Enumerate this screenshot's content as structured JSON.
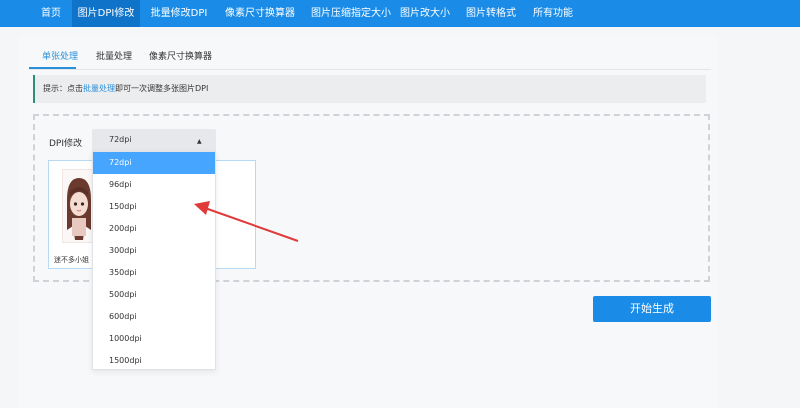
{
  "nav": {
    "items": [
      {
        "label": "首页"
      },
      {
        "label": "图片DPI修改"
      },
      {
        "label": "批量修改DPI"
      },
      {
        "label": "像素尺寸换算器"
      },
      {
        "label": "图片压缩指定大小"
      },
      {
        "label": "图片改大小"
      },
      {
        "label": "图片转格式"
      },
      {
        "label": "所有功能"
      }
    ],
    "active_index": 1
  },
  "tabs": [
    {
      "label": "单张处理",
      "active": true
    },
    {
      "label": "批量处理",
      "active": false
    },
    {
      "label": "像素尺寸换算器",
      "active": false
    }
  ],
  "tip": {
    "prefix": "提示：点击",
    "link": "批量处理",
    "suffix": "即可一次调整多张图片DPI"
  },
  "dpi": {
    "label": "DPI修改",
    "selected": "72dpi",
    "caret_icon": "▲",
    "options": [
      "72dpi",
      "96dpi",
      "150dpi",
      "200dpi",
      "300dpi",
      "350dpi",
      "500dpi",
      "600dpi",
      "1000dpi",
      "1500dpi"
    ]
  },
  "upload": {
    "file_name": "迷不多小姐"
  },
  "actions": {
    "start_label": "开始生成"
  },
  "colors": {
    "primary": "#1a8ce8",
    "nav_active": "#0f74c9",
    "option_selected": "#46a6ff",
    "arrow": "#e03a3a",
    "tip_border": "#2e8c7a"
  }
}
